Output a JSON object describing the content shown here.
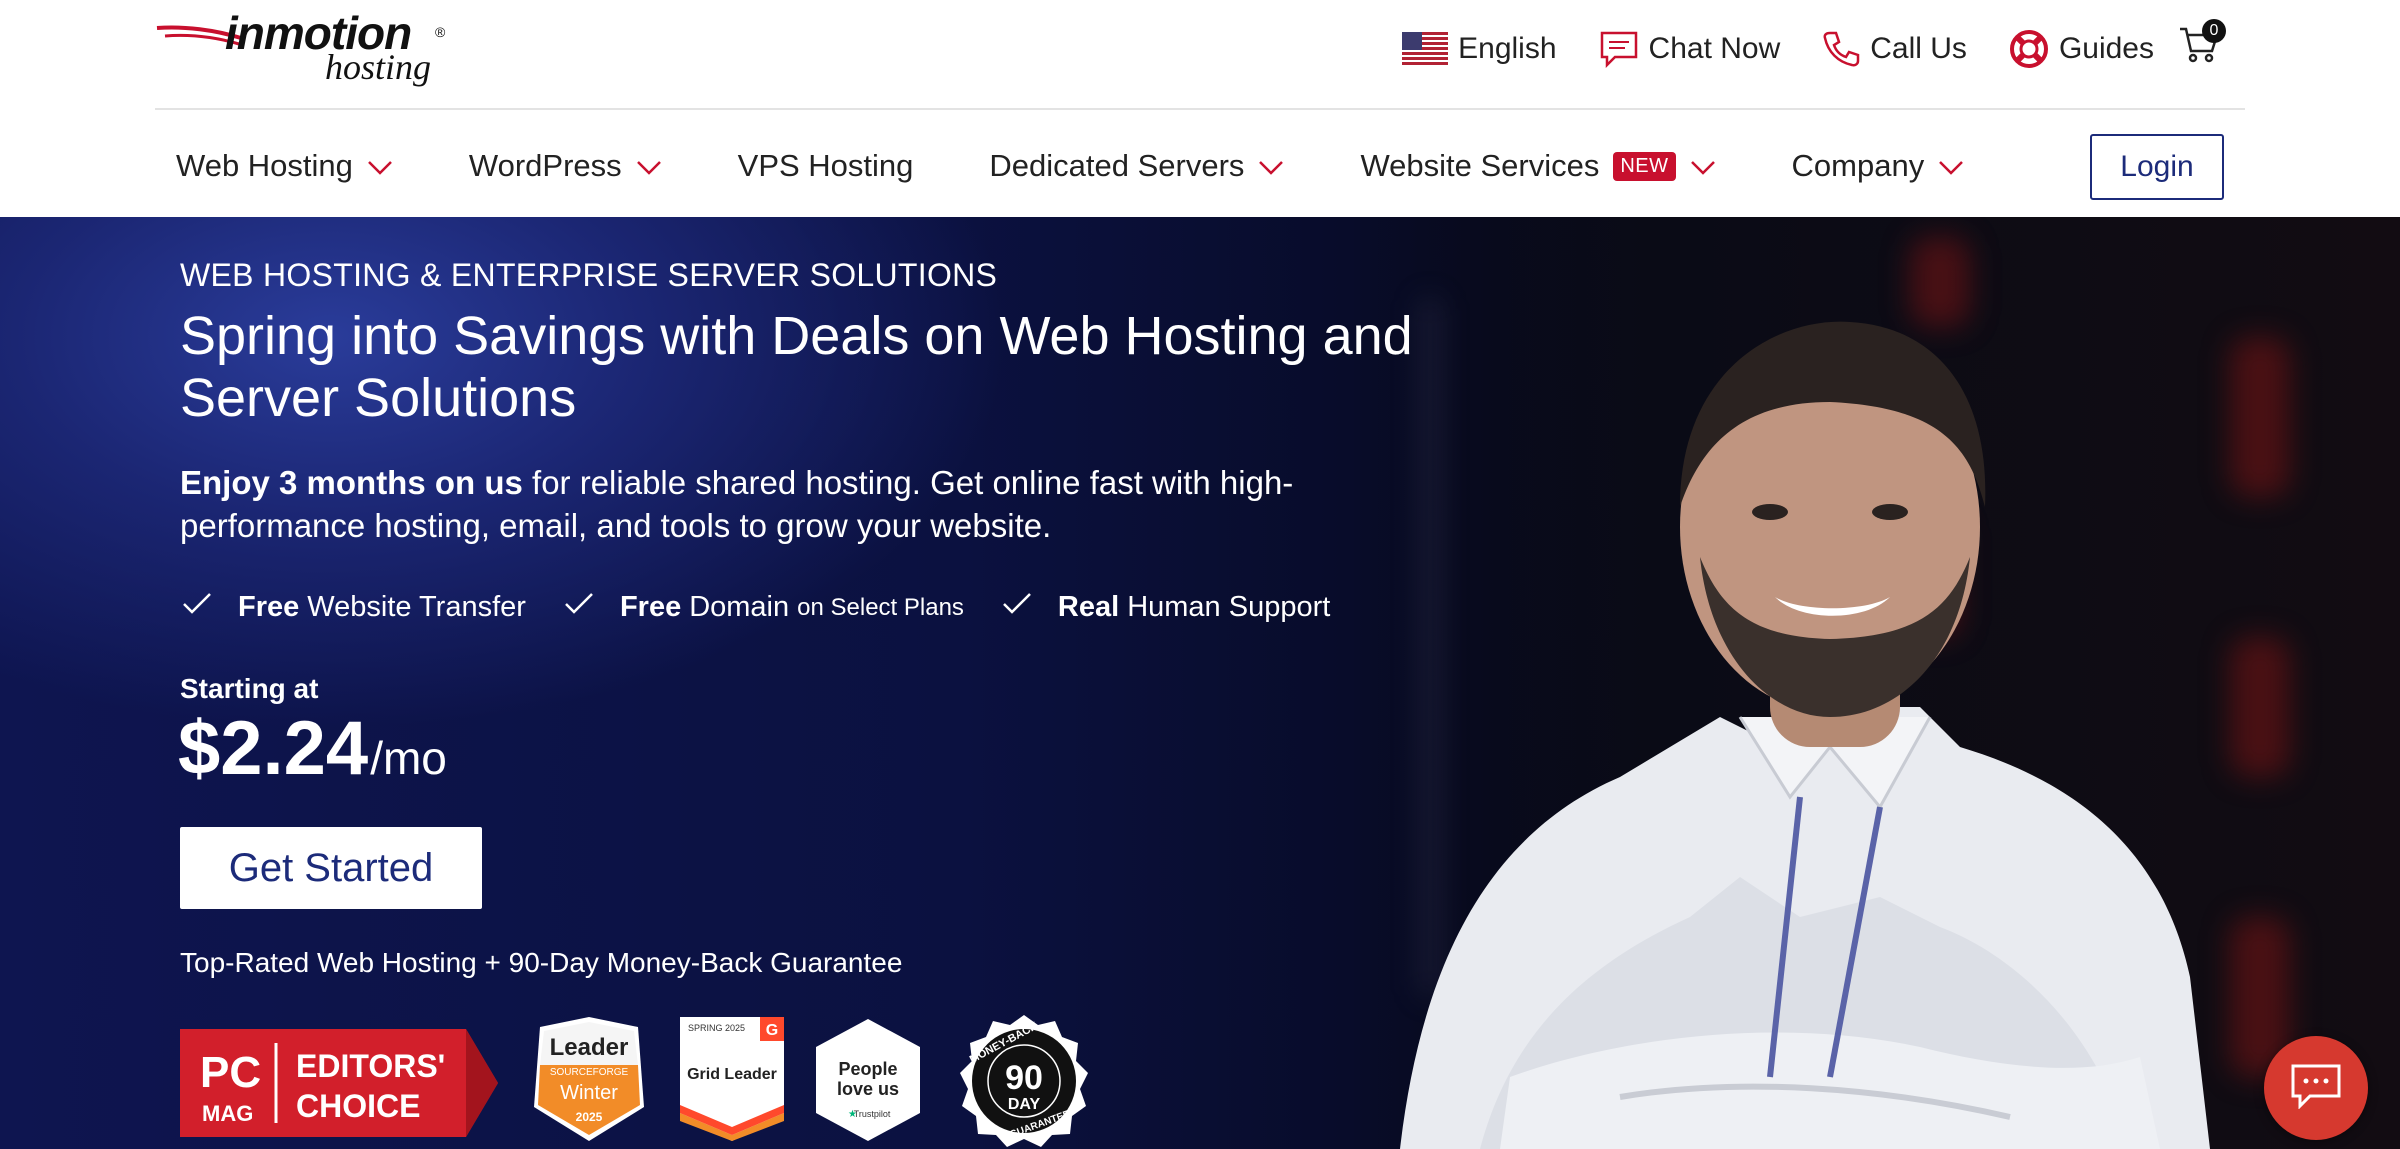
{
  "brand": {
    "word": "inmotion",
    "sub": "hosting",
    "reg": "®"
  },
  "utility": {
    "language": "English",
    "chat": "Chat Now",
    "call": "Call Us",
    "guides": "Guides",
    "cart_count": "0"
  },
  "nav": {
    "items": [
      {
        "label": "Web Hosting"
      },
      {
        "label": "WordPress"
      },
      {
        "label": "VPS Hosting"
      },
      {
        "label": "Dedicated Servers"
      },
      {
        "label": "Website Services",
        "badge": "NEW"
      },
      {
        "label": "Company"
      }
    ],
    "login": "Login"
  },
  "hero": {
    "eyebrow": "WEB HOSTING & ENTERPRISE SERVER SOLUTIONS",
    "title": "Spring into Savings with Deals on Web Hosting and Server Solutions",
    "lead_bold": "Enjoy 3 months on us",
    "lead_rest": " for reliable shared hosting. Get online fast with high-performance hosting, email, and tools to grow your website.",
    "features": [
      {
        "bold": "Free",
        "text": "Website Transfer",
        "small": ""
      },
      {
        "bold": "Free",
        "text": "Domain",
        "small": "on Select Plans"
      },
      {
        "bold": "Real",
        "text": "Human Support",
        "small": ""
      }
    ],
    "starting_label": "Starting at",
    "price": "$2.24",
    "per": "/mo",
    "cta": "Get Started",
    "guarantee": "Top-Rated Web Hosting + 90-Day Money-Back Guarantee"
  },
  "badges": {
    "pc": {
      "line1": "PC",
      "line2": "MAG",
      "line3": "EDITORS'",
      "line4": "CHOICE"
    },
    "sourceforge": {
      "title": "Leader",
      "brand": "SOURCEFORGE",
      "season": "Winter",
      "year": "2025"
    },
    "g2": {
      "season": "SPRING 2025",
      "title": "Grid Leader"
    },
    "trustpilot": {
      "line1": "People",
      "line2": "love us",
      "brand": "Trustpilot"
    },
    "moneyback": {
      "arc_top": "MONEY-BACK",
      "num": "90",
      "unit": "DAY",
      "arc_bottom": "GUARANTEE"
    }
  },
  "colors": {
    "accent": "#c8102e",
    "navy": "#1c2b7a",
    "hero_dark": "#0b1140",
    "chat_fab": "#d6392f"
  }
}
